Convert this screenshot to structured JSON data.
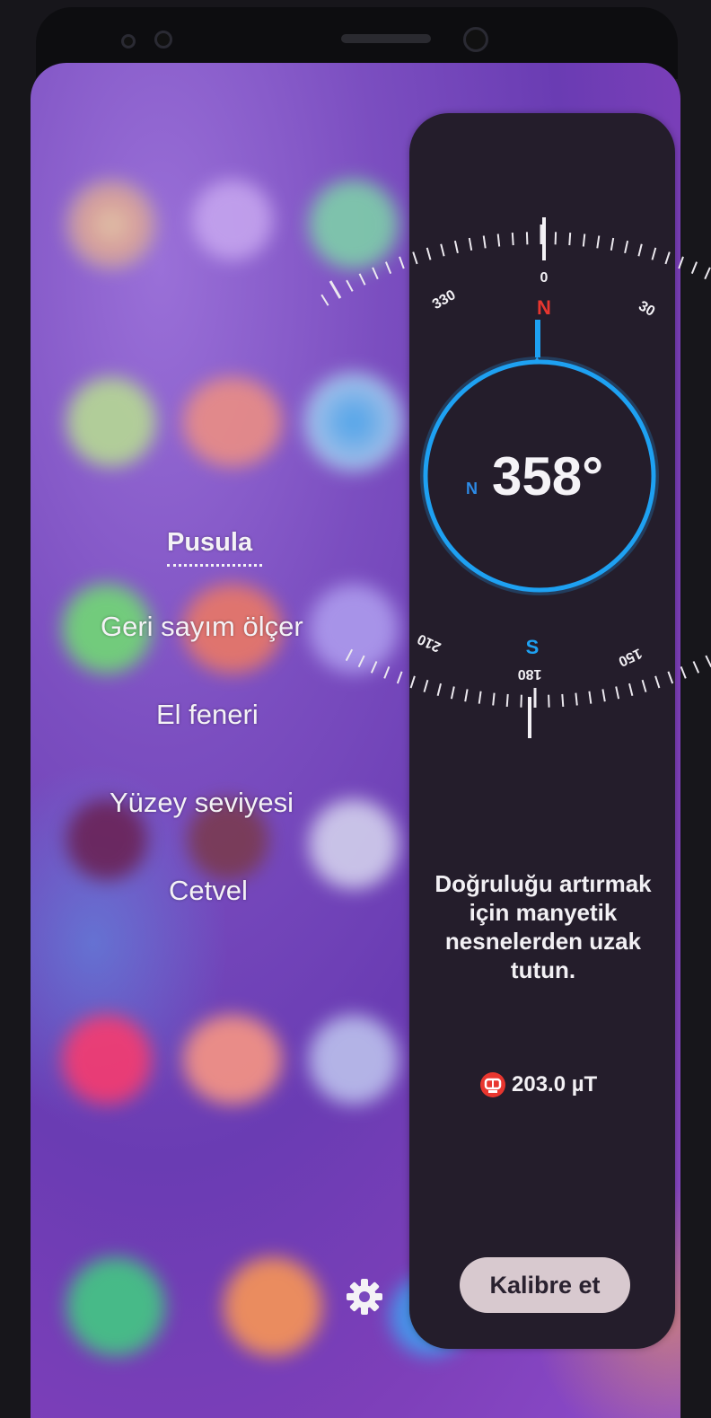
{
  "menu": {
    "items": [
      {
        "label": "Pusula",
        "active": true
      },
      {
        "label": "Geri sayım ölçer",
        "active": false
      },
      {
        "label": "El feneri",
        "active": false
      },
      {
        "label": "Yüzey seviyesi",
        "active": false
      },
      {
        "label": "Cetvel",
        "active": false
      }
    ],
    "settings_icon": "gear-icon"
  },
  "compass": {
    "heading_value": "358°",
    "direction_letter": "N",
    "top_ticks": {
      "left": "330",
      "center": "0",
      "right": "30",
      "north": "N"
    },
    "bottom_ticks": {
      "left": "210",
      "center": "180",
      "right": "150",
      "south": "S"
    },
    "accuracy_hint": "Doğruluğu artırmak için manyetik nesnelerden uzak tutun.",
    "magnetic_field": "203.0 µT",
    "magnet_icon": "magnet-icon",
    "calibrate_label": "Kalibre et"
  },
  "colors": {
    "ring": "#1ea1f2",
    "north_red": "#e8362f",
    "north_blue": "#2c8be6",
    "panel_bg": "#241d2b",
    "button_bg": "#d8c9cf"
  }
}
